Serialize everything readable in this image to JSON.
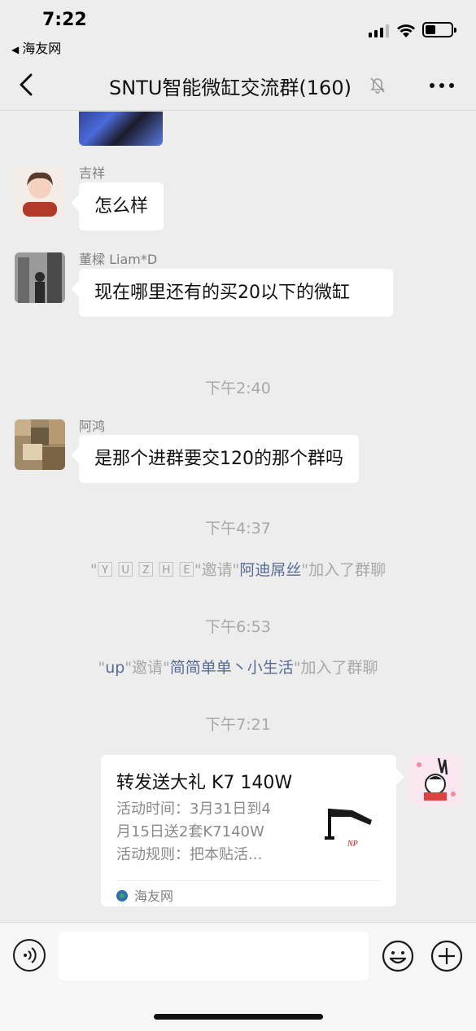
{
  "status_bar": {
    "time": "7:22",
    "back_app": "海友网"
  },
  "nav": {
    "title": "SNTU智能微缸交流群(160)"
  },
  "messages": [
    {
      "sender": "吉祥",
      "text": "怎么样"
    },
    {
      "sender": "董樑 Liam*D",
      "text": "现在哪里还有的买20以下的微缸"
    },
    {
      "sender": "阿鸿",
      "text": "是那个进群要交120的那个群吗"
    }
  ],
  "timestamps": [
    "下午2:40",
    "下午4:37",
    "下午6:53",
    "下午7:21"
  ],
  "system_messages": [
    {
      "q1": "\"",
      "inviter": "🅈 🅄 🅉 🄷 🄴",
      "q2": "\"邀请\"",
      "invitee": "阿迪屌丝",
      "tail": "\"加入了群聊"
    },
    {
      "q1": "\"",
      "inviter": "up",
      "q2": "\"邀请\"",
      "invitee": "简简单单丶小生活",
      "tail": "\"加入了群聊"
    }
  ],
  "link_card": {
    "title": "转发送大礼 K7 140W",
    "line1": "活动时间：3月31日到4",
    "line2": "月15日送2套K7140W",
    "line3": "活动规则：把本贴活...",
    "source": "海友网"
  },
  "colors": {
    "background": "#ededed",
    "bubble": "#ffffff",
    "link": "#576b95",
    "meta_text": "#a8a8a8"
  }
}
